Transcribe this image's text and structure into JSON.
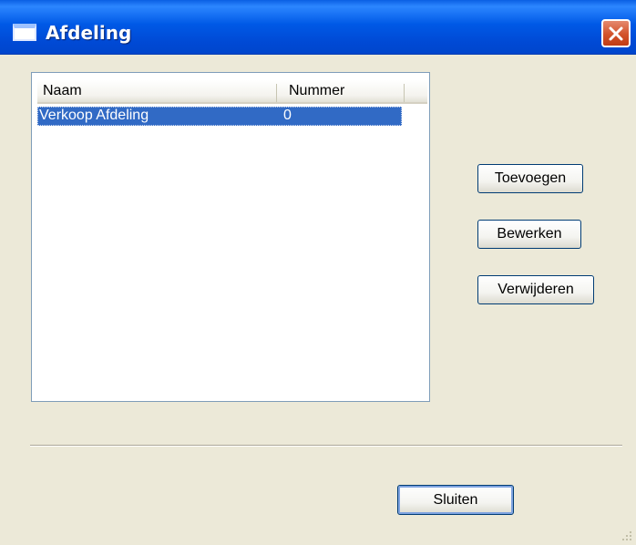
{
  "window": {
    "title": "Afdeling",
    "icons": {
      "app": "window-icon",
      "close": "close-icon"
    }
  },
  "list": {
    "columns": [
      "Naam",
      "Nummer"
    ],
    "rows": [
      {
        "naam": "Verkoop Afdeling",
        "nummer": "0",
        "selected": true
      }
    ]
  },
  "buttons": {
    "add": "Toevoegen",
    "edit": "Bewerken",
    "delete": "Verwijderen",
    "close": "Sluiten"
  },
  "colors": {
    "titlebar": "#0053e2",
    "selection": "#316ac5",
    "window_bg": "#ece9d8",
    "close_button": "#d2522b"
  }
}
